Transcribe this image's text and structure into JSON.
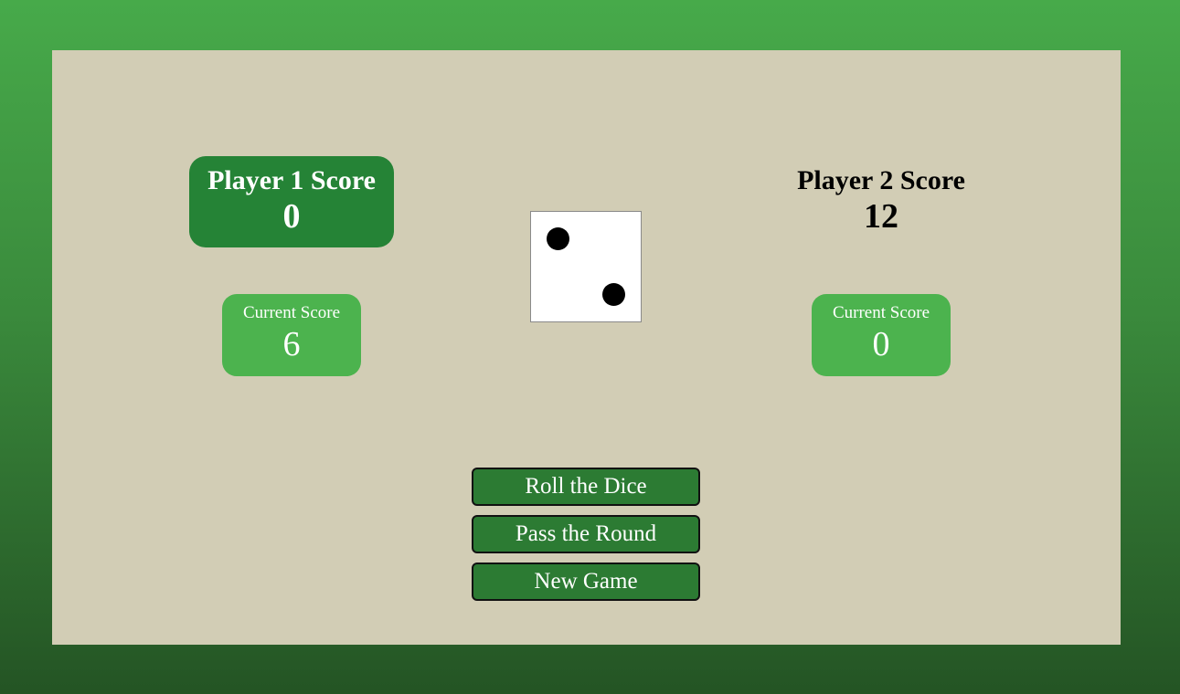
{
  "player1": {
    "title": "Player 1 Score",
    "score": "0",
    "current_label": "Current Score",
    "current_score": "6",
    "active": true
  },
  "player2": {
    "title": "Player 2 Score",
    "score": "12",
    "current_label": "Current Score",
    "current_score": "0",
    "active": false
  },
  "dice": {
    "value": 2
  },
  "buttons": {
    "roll": "Roll the Dice",
    "pass": "Pass the Round",
    "new_game": "New Game"
  },
  "colors": {
    "active_player_bg": "#258336",
    "current_score_bg": "#4cb34e",
    "board_bg": "#d2cdb5",
    "button_bg": "#2c7b33"
  }
}
